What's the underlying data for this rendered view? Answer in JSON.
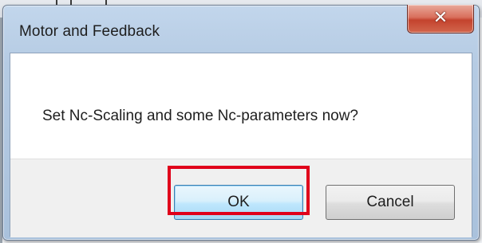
{
  "dialog": {
    "title": "Motor and Feedback",
    "message": "Set Nc-Scaling and some Nc-parameters now?",
    "close_icon": "close-icon",
    "buttons": {
      "ok_label": "OK",
      "cancel_label": "Cancel"
    },
    "highlight_target": "ok-button"
  },
  "colors": {
    "close_button": "#c4432e",
    "highlight_frame": "#e0001b",
    "title_bar": "#b5cbe3"
  }
}
